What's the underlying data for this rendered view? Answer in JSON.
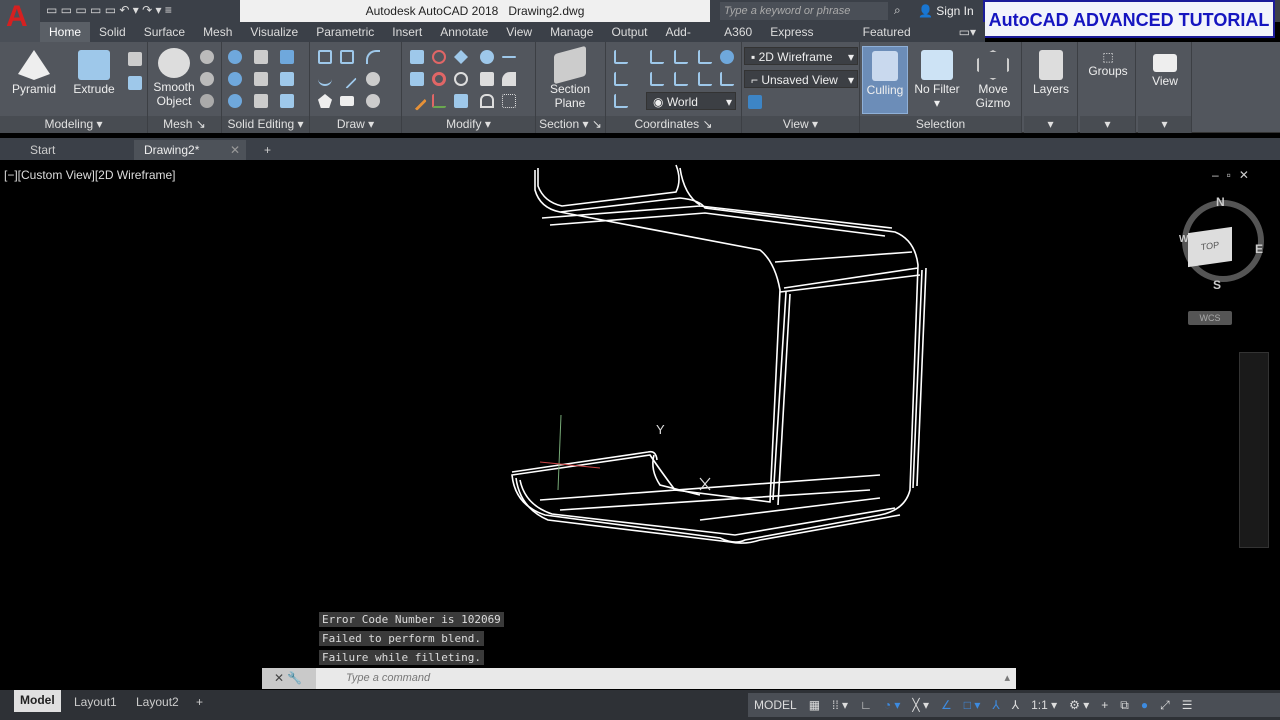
{
  "title": "Autodesk AutoCAD 2018",
  "document": "Drawing2.dwg",
  "search_placeholder": "Type a keyword or phrase",
  "sign_in": "Sign In",
  "overlay_banner": "AutoCAD ADVANCED TUTORIAL",
  "tabs": [
    "Home",
    "Solid",
    "Surface",
    "Mesh",
    "Visualize",
    "Parametric",
    "Insert",
    "Annotate",
    "View",
    "Manage",
    "Output",
    "Add-ins",
    "A360",
    "Express Tools",
    "Featured Apps"
  ],
  "ribbon": {
    "modeling": {
      "label": "Modeling",
      "pyramid": "Pyramid",
      "extrude": "Extrude"
    },
    "mesh": {
      "label": "Mesh",
      "smooth1": "Smooth",
      "smooth2": "Object"
    },
    "solid_editing": {
      "label": "Solid Editing"
    },
    "draw": {
      "label": "Draw"
    },
    "modify": {
      "label": "Modify"
    },
    "section": {
      "label": "Section",
      "plane1": "Section",
      "plane2": "Plane"
    },
    "coordinates": {
      "label": "Coordinates",
      "ucs": "World"
    },
    "view": {
      "label": "View",
      "visual_style": "2D Wireframe",
      "named_view": "Unsaved View"
    },
    "selection": {
      "label": "Selection",
      "culling": "Culling",
      "filter": "No Filter",
      "gizmo1": "Move",
      "gizmo2": "Gizmo"
    },
    "layers": "Layers",
    "groups": "Groups",
    "view_btn": "View"
  },
  "file_tabs": [
    "Start",
    "Drawing2*"
  ],
  "viewport_label": "[−][Custom View][2D Wireframe]",
  "viewcube": {
    "n": "N",
    "s": "S",
    "e": "E",
    "w": "W",
    "top": "TOP",
    "wcs": "WCS"
  },
  "ucs_y": "Y",
  "messages": [
    "Error Code Number is 102069",
    "Failed to perform blend.",
    "Failure while filleting."
  ],
  "command_placeholder": "Type a command",
  "layout_tabs": [
    "Model",
    "Layout1",
    "Layout2"
  ],
  "status": {
    "model": "MODEL",
    "scale": "1:1"
  }
}
